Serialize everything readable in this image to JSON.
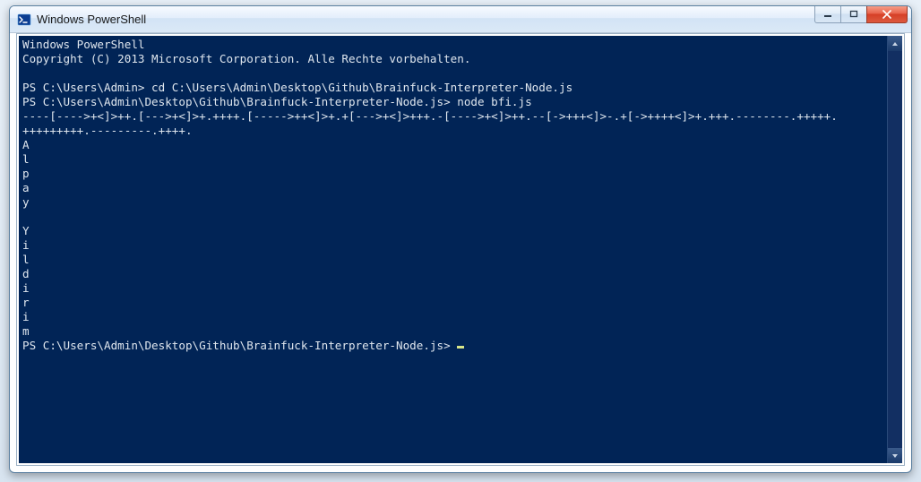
{
  "window": {
    "title": "Windows PowerShell"
  },
  "console": {
    "line1": "Windows PowerShell",
    "line2": "Copyright (C) 2013 Microsoft Corporation. Alle Rechte vorbehalten.",
    "blank1": "",
    "prompt1": "PS C:\\Users\\Admin> cd C:\\Users\\Admin\\Desktop\\Github\\Brainfuck-Interpreter-Node.js",
    "prompt2": "PS C:\\Users\\Admin\\Desktop\\Github\\Brainfuck-Interpreter-Node.js> node bfi.js",
    "code1": "----[---->+<]>++.[--->+<]>+.++++.[----->++<]>+.+[--->+<]>+++.-[---->+<]>++.--[->+++<]>-.+[->++++<]>+.+++.--------.+++++.",
    "code2": "+++++++++.---------.++++.",
    "outA": "A",
    "outl1": "l",
    "outp": "p",
    "outa": "a",
    "outy": "y",
    "blank2": "",
    "outY": "Y",
    "outi1": "i",
    "outl2": "l",
    "outd": "d",
    "outi2": "i",
    "outr": "r",
    "outi3": "i",
    "outm": "m",
    "prompt3": "PS C:\\Users\\Admin\\Desktop\\Github\\Brainfuck-Interpreter-Node.js> "
  }
}
